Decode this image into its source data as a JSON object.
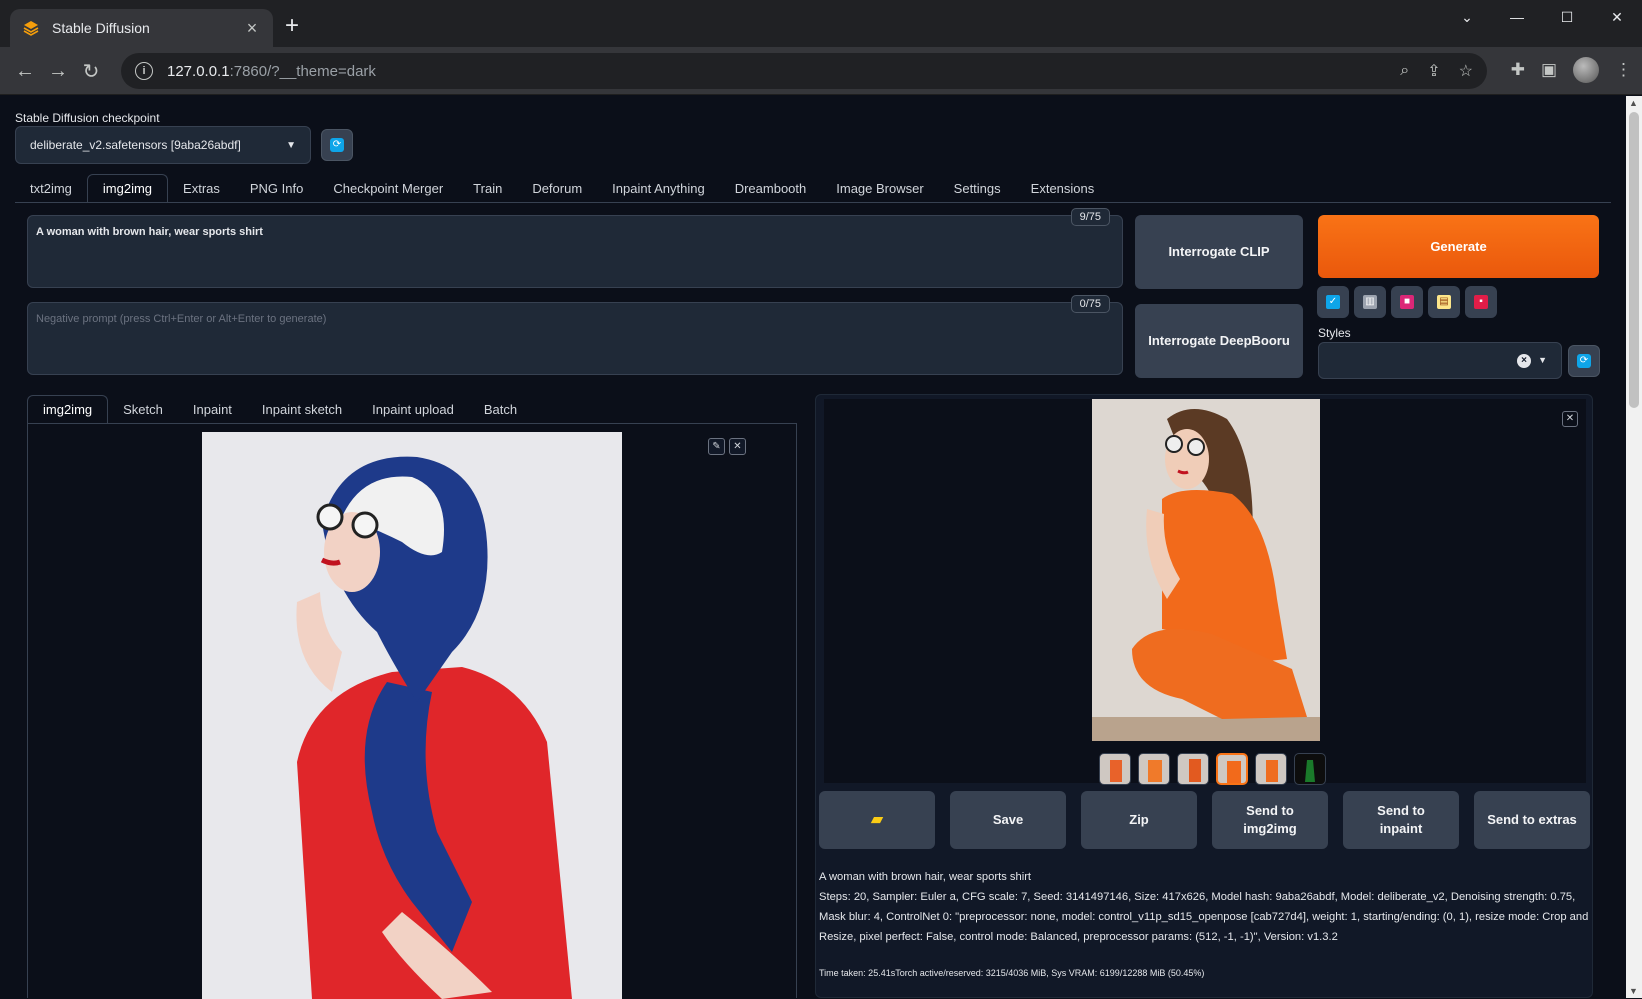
{
  "browser": {
    "tab_title": "Stable Diffusion",
    "url_host": "127.0.0.1",
    "url_rest": ":7860/?__theme=dark"
  },
  "checkpoint": {
    "label": "Stable Diffusion checkpoint",
    "value": "deliberate_v2.safetensors [9aba26abdf]"
  },
  "main_tabs": [
    "txt2img",
    "img2img",
    "Extras",
    "PNG Info",
    "Checkpoint Merger",
    "Train",
    "Deforum",
    "Inpaint Anything",
    "Dreambooth",
    "Image Browser",
    "Settings",
    "Extensions"
  ],
  "prompt": {
    "text": "A woman with brown hair, wear sports shirt",
    "counter": "9/75"
  },
  "negative_prompt": {
    "placeholder": "Negative prompt (press Ctrl+Enter or Alt+Enter to generate)",
    "counter": "0/75"
  },
  "buttons": {
    "interrogate_clip": "Interrogate CLIP",
    "interrogate_deepbooru": "Interrogate DeepBooru",
    "generate": "Generate"
  },
  "styles": {
    "label": "Styles"
  },
  "sub_tabs": [
    "img2img",
    "Sketch",
    "Inpaint",
    "Inpaint sketch",
    "Inpaint upload",
    "Batch"
  ],
  "actions": {
    "save": "Save",
    "zip": "Zip",
    "send_img2img": "Send to img2img",
    "send_inpaint": "Send to inpaint",
    "send_extras": "Send to extras"
  },
  "generation_info": {
    "prompt": "A woman with brown hair, wear sports shirt",
    "params": "Steps: 20, Sampler: Euler a, CFG scale: 7, Seed: 3141497146, Size: 417x626, Model hash: 9aba26abdf, Model: deliberate_v2, Denoising strength: 0.75, Mask blur: 4, ControlNet 0: \"preprocessor: none, model: control_v11p_sd15_openpose [cab727d4], weight: 1, starting/ending: (0, 1), resize mode: Crop and Resize, pixel perfect: False, control mode: Balanced, preprocessor params: (512, -1, -1)\", Version: v1.3.2",
    "time": "Time taken: 25.41sTorch active/reserved: 3215/4036 MiB, Sys VRAM: 6199/12288 MiB (50.45%)"
  },
  "colors": {
    "background": "#0b0f19",
    "generate": "#f97316",
    "accent_blue": "#0ea5e9"
  }
}
